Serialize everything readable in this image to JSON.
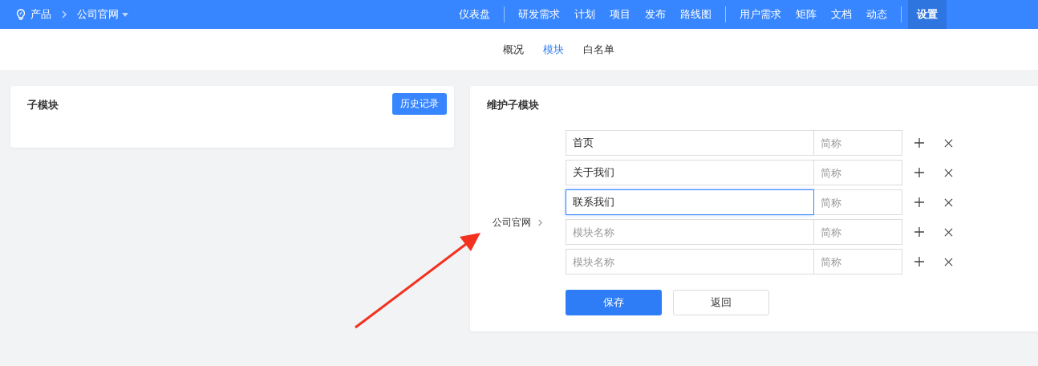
{
  "breadcrumb": {
    "product_label": "产品",
    "current": "公司官网"
  },
  "nav_groups": [
    [
      {
        "label": "仪表盘",
        "selected": false
      }
    ],
    [
      {
        "label": "研发需求",
        "selected": false
      },
      {
        "label": "计划",
        "selected": false
      },
      {
        "label": "项目",
        "selected": false
      },
      {
        "label": "发布",
        "selected": false
      },
      {
        "label": "路线图",
        "selected": false
      }
    ],
    [
      {
        "label": "用户需求",
        "selected": false
      },
      {
        "label": "矩阵",
        "selected": false
      },
      {
        "label": "文档",
        "selected": false
      },
      {
        "label": "动态",
        "selected": false
      }
    ],
    [
      {
        "label": "设置",
        "selected": true
      }
    ]
  ],
  "sub_tabs": [
    {
      "label": "概况",
      "selected": false
    },
    {
      "label": "模块",
      "selected": true
    },
    {
      "label": "白名单",
      "selected": false
    }
  ],
  "submodule_panel": {
    "title": "子模块",
    "history_button": "历史记录"
  },
  "maintain_panel": {
    "title": "维护子模块",
    "parent_label": "公司官网",
    "rows": [
      {
        "value": "首页",
        "abbr_placeholder": "简称",
        "focused": false
      },
      {
        "value": "关于我们",
        "abbr_placeholder": "简称",
        "focused": false
      },
      {
        "value": "联系我们",
        "abbr_placeholder": "简称",
        "focused": true
      },
      {
        "placeholder": "模块名称",
        "abbr_placeholder": "简称",
        "focused": false
      },
      {
        "placeholder": "模块名称",
        "abbr_placeholder": "简称",
        "focused": false
      }
    ],
    "buttons": [
      {
        "label": "保存",
        "kind": "primary"
      },
      {
        "label": "返回",
        "kind": "secondary"
      }
    ]
  }
}
